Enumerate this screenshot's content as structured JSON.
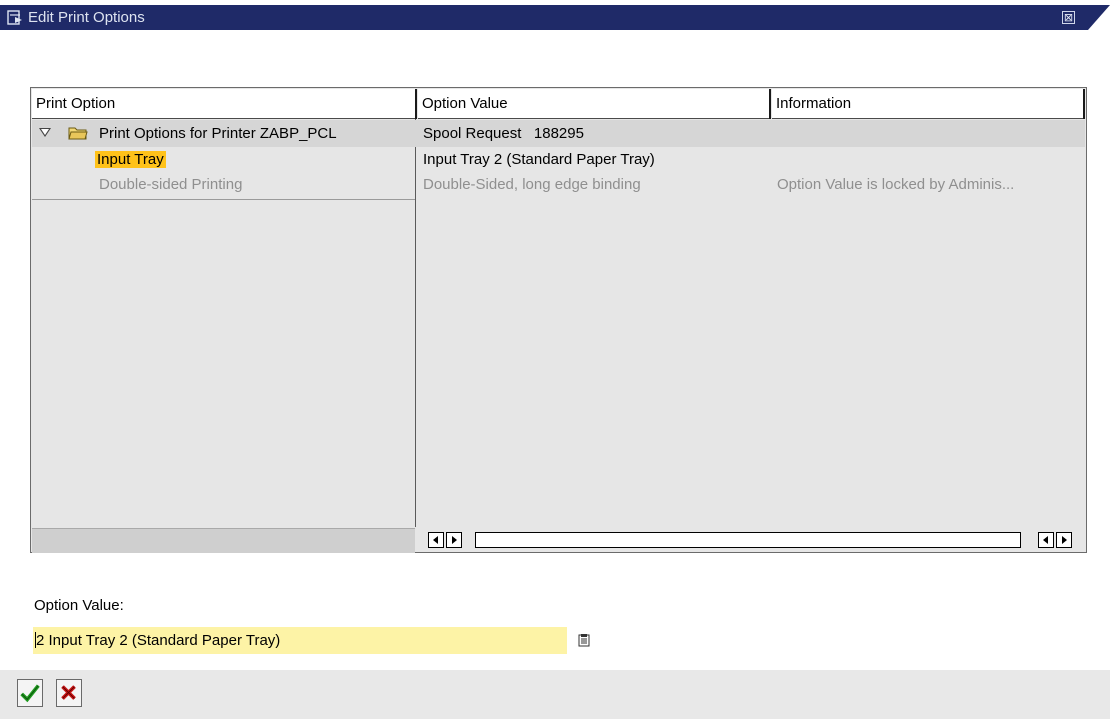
{
  "window": {
    "title": "Edit Print Options",
    "close_glyph": "⊠"
  },
  "tree": {
    "columns": [
      "Print Option",
      "Option Value",
      "Information"
    ],
    "rows": [
      {
        "option": "Print Options for Printer ZABP_PCL",
        "value": "Spool Request   188295",
        "info": "",
        "expanded": true,
        "icon": "folder-open-icon"
      },
      {
        "option": "Input Tray",
        "value": "Input Tray 2 (Standard Paper Tray)",
        "info": "",
        "selected": true
      },
      {
        "option": "Double-sided Printing",
        "value": "Double-Sided, long edge binding",
        "info": "Option Value is locked by Adminis...",
        "disabled": true
      }
    ]
  },
  "option_value": {
    "label": "Option Value:",
    "value": "2 Input Tray 2 (Standard Paper Tray)",
    "value_rest": " Input Tray 2 (Standard Paper Tray)",
    "first_char": "2"
  },
  "buttons": {
    "confirm": "checkmark-icon",
    "cancel": "cancel-x-icon"
  },
  "colors": {
    "title_bar": "#1f2a68",
    "highlight": "#ffc21a",
    "input_bg": "#fdf3a6",
    "confirm_green": "#1e9a1e",
    "cancel_red": "#c81414"
  }
}
